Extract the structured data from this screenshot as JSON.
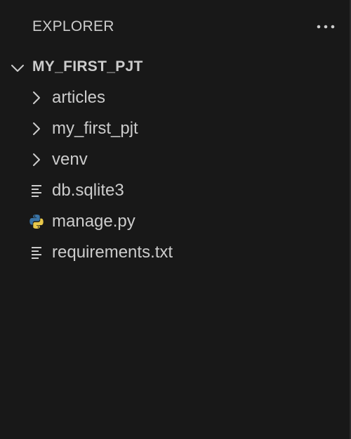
{
  "explorer": {
    "title": "EXPLORER",
    "more_actions_label": "···"
  },
  "workspace": {
    "folder_name": "MY_FIRST_PJT",
    "expanded": true,
    "items": [
      {
        "label": "articles",
        "kind": "folder",
        "icon": "chevron-right-icon"
      },
      {
        "label": "my_first_pjt",
        "kind": "folder",
        "icon": "chevron-right-icon"
      },
      {
        "label": "venv",
        "kind": "folder",
        "icon": "chevron-right-icon"
      },
      {
        "label": "db.sqlite3",
        "kind": "file",
        "icon": "text-file-icon"
      },
      {
        "label": "manage.py",
        "kind": "file",
        "icon": "python-file-icon"
      },
      {
        "label": "requirements.txt",
        "kind": "file",
        "icon": "text-file-icon"
      }
    ]
  },
  "colors": {
    "background": "#181818",
    "text": "#cccccc",
    "python_blue": "#3a74a6",
    "python_yellow": "#e8c84a"
  }
}
